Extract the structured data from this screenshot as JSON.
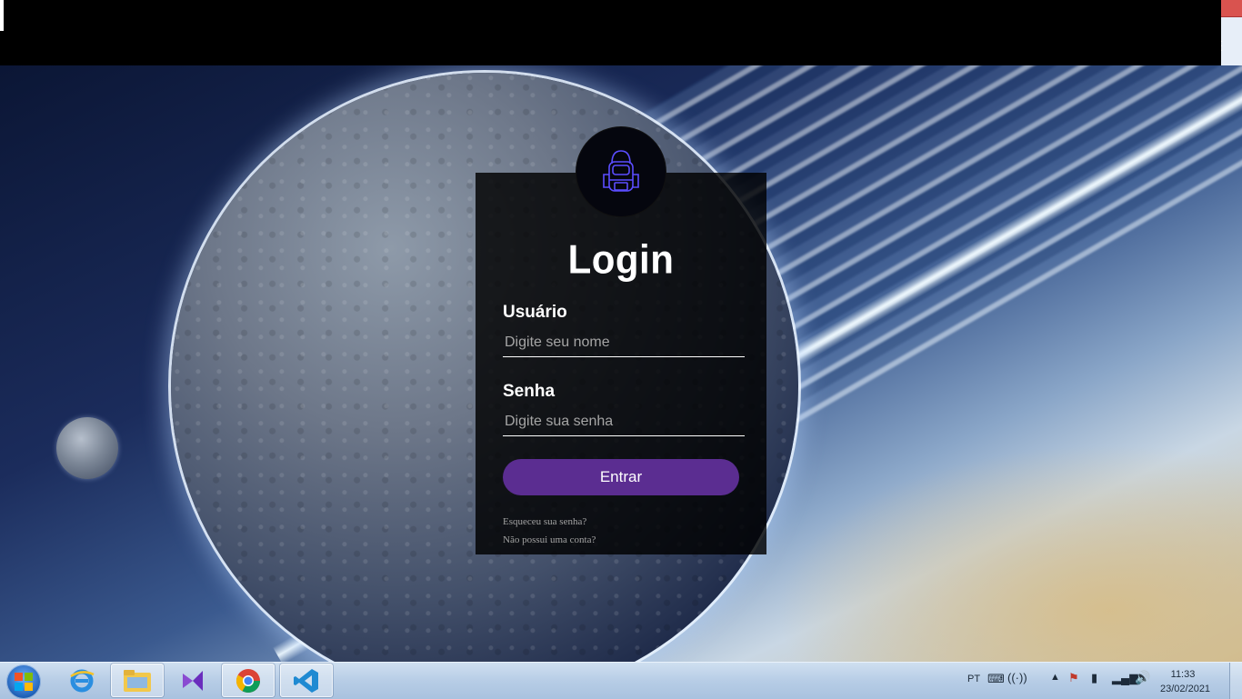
{
  "login": {
    "title": "Login",
    "username_label": "Usuário",
    "username_placeholder": "Digite seu nome",
    "password_label": "Senha",
    "password_placeholder": "Digite sua senha",
    "submit_label": "Entrar",
    "forgot_link": "Esqueceu sua senha?",
    "signup_link": "Não possui uma conta?",
    "avatar_icon": "astronaut-backpack-icon"
  },
  "taskbar": {
    "apps": [
      {
        "name": "internet-explorer-icon"
      },
      {
        "name": "file-explorer-icon"
      },
      {
        "name": "visual-studio-icon"
      },
      {
        "name": "chrome-icon"
      },
      {
        "name": "vscode-icon"
      }
    ],
    "language": "PT",
    "time": "11:33",
    "date": "23/02/2021"
  },
  "colors": {
    "button": "#5b2d91",
    "card": "#000000",
    "avatar_outline": "#5b4dff"
  }
}
